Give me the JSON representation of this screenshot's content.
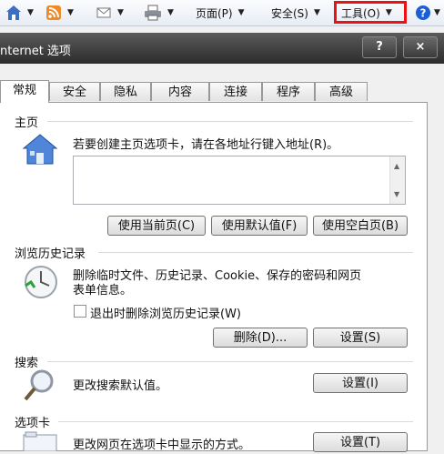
{
  "toolbar": {
    "page_label": "页面(P)",
    "safety_label": "安全(S)",
    "tools_label": "工具(O)"
  },
  "dialog": {
    "title": "nternet 选项",
    "help_btn": "?",
    "close_btn": "×"
  },
  "tabs": [
    "常规",
    "安全",
    "隐私",
    "内容",
    "连接",
    "程序",
    "高级"
  ],
  "homepage": {
    "heading": "主页",
    "desc": "若要创建主页选项卡，请在各地址行键入地址(R)。",
    "btn_current": "使用当前页(C)",
    "btn_default": "使用默认值(F)",
    "btn_blank": "使用空白页(B)"
  },
  "history": {
    "heading": "浏览历史记录",
    "desc_line1": "删除临时文件、历史记录、Cookie、保存的密码和网页",
    "desc_line2": "表单信息。",
    "checkbox_label": "退出时删除浏览历史记录(W)",
    "btn_delete": "删除(D)...",
    "btn_settings": "设置(S)"
  },
  "search": {
    "heading": "搜索",
    "desc": "更改搜索默认值。",
    "btn_settings": "设置(I)"
  },
  "tabsec": {
    "heading": "选项卡",
    "desc": "更改网页在选项卡中显示的方式。",
    "btn_settings": "设置(T)"
  },
  "colors": {
    "highlight": "#e11111",
    "help_icon": "#1a5fd6"
  }
}
